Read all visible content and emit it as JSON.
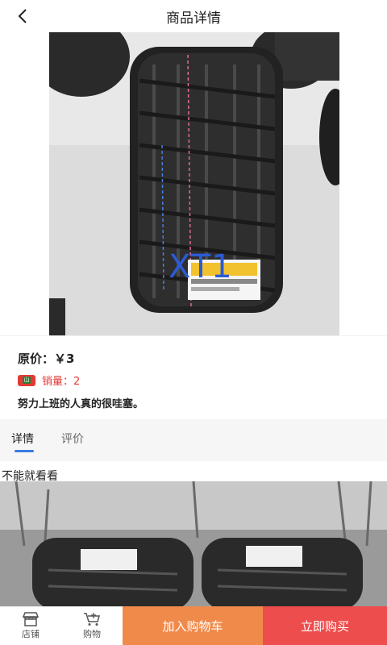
{
  "header": {
    "title": "商品详情"
  },
  "hero": {
    "overlay_text": "XT1"
  },
  "product": {
    "price_label": "原价：￥3",
    "sales_label": "销量：2",
    "badge_text": "山",
    "description": "努力上班的人真的很哇塞。"
  },
  "tabs": [
    {
      "label": "详情",
      "active": true
    },
    {
      "label": "评价",
      "active": false
    }
  ],
  "detail": {
    "text": "不能就看看"
  },
  "bottom_bar": {
    "store_label": "店铺",
    "cart_label": "购物",
    "add_to_cart": "加入购物车",
    "buy_now": "立即购买"
  },
  "colors": {
    "accent_blue": "#3a7be0",
    "price_red": "#e53935",
    "cart_orange": "#f08a4b",
    "buy_red": "#ee4d4d"
  }
}
